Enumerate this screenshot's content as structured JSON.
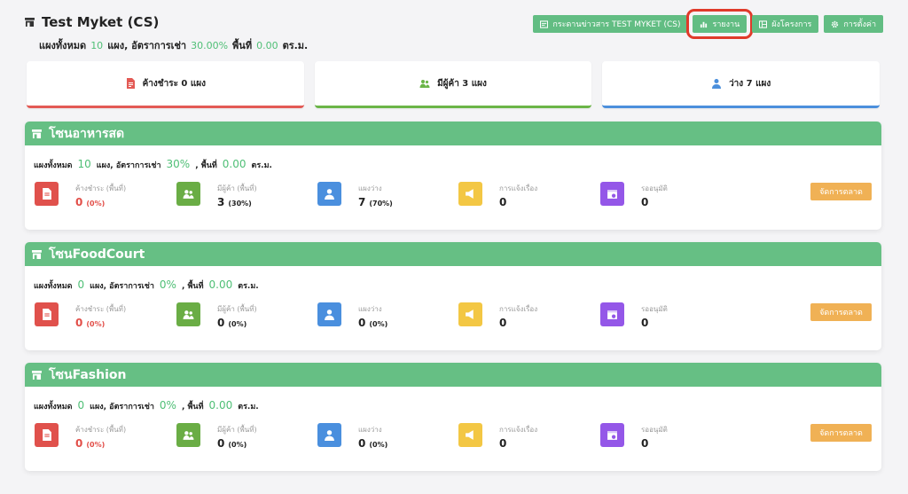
{
  "header": {
    "title": "Test Myket (CS)",
    "summary": {
      "label_total": "แผงทั้งหมด",
      "total": "10",
      "label_rent": "แผง, อัตราการเช่า",
      "rent": "30.00%",
      "label_area": "พื้นที่",
      "area": "0.00",
      "unit": "ตร.ม."
    }
  },
  "toolbar": [
    {
      "label": "กระดานข่าวสาร TEST MYKET (CS)",
      "icon": "board-icon"
    },
    {
      "label": "รายงาน",
      "icon": "bar-chart-icon"
    },
    {
      "label": "ผังโครงการ",
      "icon": "map-icon"
    },
    {
      "label": "การตั้งค่า",
      "icon": "gear-icon"
    }
  ],
  "cards": [
    {
      "label": "ค้างชำระ 0 แผง",
      "color": "#e35a55",
      "icon": "document-icon"
    },
    {
      "label": "มีผู้ค้า 3 แผง",
      "color": "#6bb548",
      "icon": "users-icon"
    },
    {
      "label": "ว่าง 7 แผง",
      "color": "#4b8fdc",
      "icon": "user-icon"
    }
  ],
  "zone_labels": {
    "total": "แผงทั้งหมด",
    "rent": "แผง, อัตราการเช่า",
    "area": ", พื้นที่",
    "unit": "ตร.ม.",
    "stat_overdue": "ค้างชำระ (พื้นที่)",
    "stat_tenant": "มีผู้ค้า (พื้นที่)",
    "stat_vacant": "แผงว่าง",
    "stat_report": "การแจ้งเรื่อง",
    "stat_pending": "รออนุมัติ",
    "manage": "จัดการตลาด"
  },
  "zones": [
    {
      "name": "โซนอาหารสด",
      "total": "10",
      "rent": "30%",
      "area": "0.00",
      "overdue": "0",
      "overdue_pct": "(0%)",
      "tenant": "3",
      "tenant_pct": "(30%)",
      "vacant": "7",
      "vacant_pct": "(70%)",
      "report": "0",
      "pending": "0"
    },
    {
      "name": "โซนFoodCourt",
      "total": "0",
      "rent": "0%",
      "area": "0.00",
      "overdue": "0",
      "overdue_pct": "(0%)",
      "tenant": "0",
      "tenant_pct": "(0%)",
      "vacant": "0",
      "vacant_pct": "(0%)",
      "report": "0",
      "pending": "0"
    },
    {
      "name": "โซนFashion",
      "total": "0",
      "rent": "0%",
      "area": "0.00",
      "overdue": "0",
      "overdue_pct": "(0%)",
      "tenant": "0",
      "tenant_pct": "(0%)",
      "vacant": "0",
      "vacant_pct": "(0%)",
      "report": "0",
      "pending": "0"
    }
  ],
  "colors": {
    "accent": "#62bd83",
    "overdue": "#e0514c",
    "tenant": "#6aad45",
    "vacant": "#4a8fde",
    "report": "#f3c744",
    "pending": "#9457e8",
    "manage": "#f0b155"
  }
}
